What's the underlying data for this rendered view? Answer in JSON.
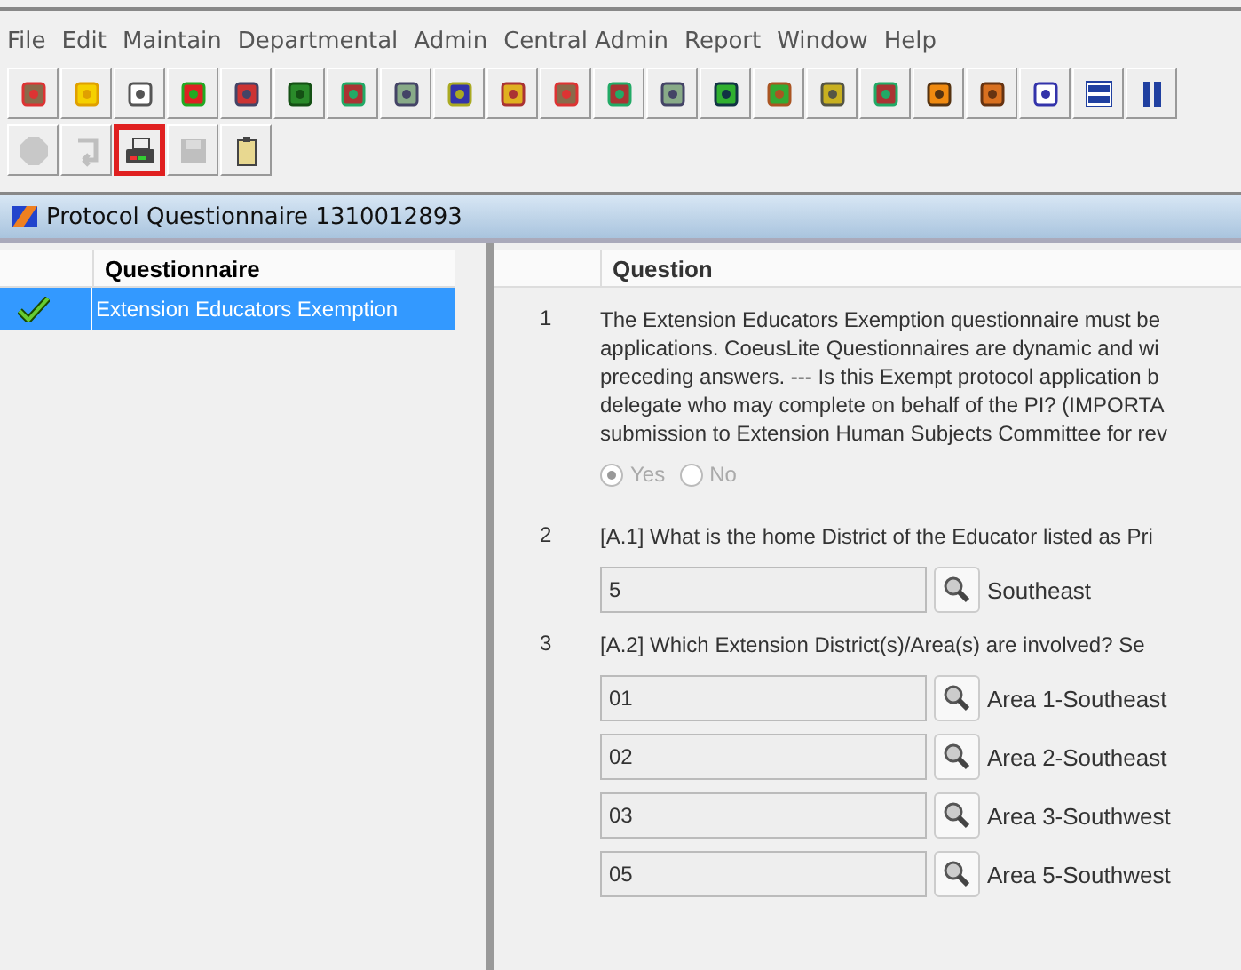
{
  "menu": [
    "File",
    "Edit",
    "Maintain",
    "Departmental",
    "Admin",
    "Central Admin",
    "Report",
    "Window",
    "Help"
  ],
  "toolbar1": [
    {
      "kind": "person"
    },
    {
      "kind": "gem"
    },
    {
      "kind": "pages"
    },
    {
      "kind": "flow"
    },
    {
      "kind": "cards"
    },
    {
      "kind": "bottle"
    },
    {
      "kind": "people"
    },
    {
      "kind": "tree"
    },
    {
      "kind": "formula"
    },
    {
      "kind": "folders"
    },
    {
      "kind": "person"
    },
    {
      "kind": "people"
    },
    {
      "kind": "tree"
    },
    {
      "kind": "greenbook"
    },
    {
      "kind": "greenperson"
    },
    {
      "kind": "clock"
    },
    {
      "kind": "people"
    },
    {
      "kind": "orangebook"
    },
    {
      "kind": "orangeperson"
    },
    {
      "kind": "links"
    },
    {
      "kind": "rows"
    },
    {
      "kind": "cols"
    }
  ],
  "toolbar2": [
    {
      "kind": "stop",
      "disabled": true,
      "selected": false
    },
    {
      "kind": "undo",
      "disabled": true,
      "selected": false
    },
    {
      "kind": "printer",
      "disabled": false,
      "selected": true
    },
    {
      "kind": "save",
      "disabled": true,
      "selected": false
    },
    {
      "kind": "clipboard",
      "disabled": false,
      "selected": false
    }
  ],
  "window": {
    "title": "Protocol Questionnaire 1310012893"
  },
  "questionnaires": {
    "header": "Questionnaire",
    "items": [
      {
        "name": "Extension Educators Exemption",
        "completed": true,
        "selected": true
      }
    ]
  },
  "questions": {
    "header": "Question",
    "items": [
      {
        "number": "1",
        "kind": "radio",
        "lines": [
          "The Extension Educators Exemption questionnaire must be",
          "applications.  CoeusLite Questionnaires are dynamic and wi",
          "preceding answers. --- Is this Exempt protocol application b",
          "delegate who may complete on behalf of the PI?  (IMPORTA",
          "submission to Extension Human Subjects Committee for rev"
        ],
        "disabled": true,
        "options": [
          {
            "label": "Yes",
            "selected": true
          },
          {
            "label": "No",
            "selected": false
          }
        ]
      },
      {
        "number": "2",
        "kind": "lookup",
        "lines": [
          "[A.1]  What is the home District of the Educator listed as Pri"
        ],
        "answers": [
          {
            "value": "5",
            "description": "Southeast"
          }
        ]
      },
      {
        "number": "3",
        "kind": "lookup",
        "lines": [
          "[A.2]  Which Extension District(s)/Area(s) are involved?  Se"
        ],
        "answers": [
          {
            "value": "01",
            "description": "Area 1-Southeast"
          },
          {
            "value": "02",
            "description": "Area 2-Southeast"
          },
          {
            "value": "03",
            "description": "Area 3-Southwest"
          },
          {
            "value": "05",
            "description": "Area 5-Southwest"
          }
        ]
      }
    ]
  }
}
